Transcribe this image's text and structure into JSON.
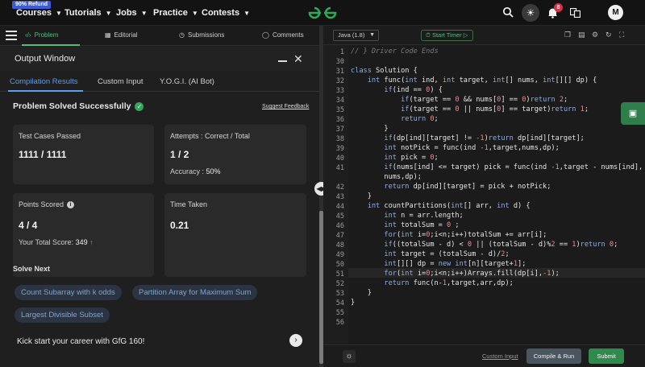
{
  "nav": {
    "refund_badge": "90% Refund",
    "items": [
      "Courses",
      "Tutorials",
      "Jobs",
      "Practice",
      "Contests"
    ],
    "notification_count": "8",
    "avatar_initial": "M"
  },
  "problem_tabs": [
    "Problem",
    "Editorial",
    "Submissions",
    "Comments"
  ],
  "output": {
    "title": "Output Window",
    "tabs": [
      "Compilation Results",
      "Custom Input",
      "Y.O.G.I. (AI Bot)"
    ],
    "status": "Problem Solved Successfully",
    "feedback": "Suggest Feedback",
    "cards": {
      "test_cases": {
        "label": "Test Cases Passed",
        "value": "1111 / 1111"
      },
      "attempts": {
        "label": "Attempts : Correct / Total",
        "value": "1 / 2",
        "sub_label": "Accuracy :",
        "sub_value": "50%"
      },
      "points": {
        "label": "Points Scored",
        "value": "4 / 4",
        "sub_label": "Your Total Score:",
        "sub_value": "349"
      },
      "time": {
        "label": "Time Taken",
        "value": "0.21"
      }
    },
    "solve_next": {
      "title": "Solve Next",
      "items": [
        "Count Subarray with k odds",
        "Partition Array for Maximum Sum",
        "Largest Divisible Subset"
      ]
    },
    "kickstart": "Kick start your career with GfG 160!"
  },
  "editor": {
    "language": "Java (1.8)",
    "timer_label": "Start Timer",
    "custom_input": "Custom Input",
    "compile_label": "Compile & Run",
    "submit_label": "Submit",
    "lines": [
      {
        "n": "1",
        "t": "// } Driver Code Ends"
      },
      {
        "n": "30",
        "t": ""
      },
      {
        "n": "31",
        "t": "class Solution {"
      },
      {
        "n": "32",
        "t": "    int func(int ind, int target, int[] nums, int[][] dp) {"
      },
      {
        "n": "33",
        "t": "        if(ind == 0) {"
      },
      {
        "n": "34",
        "t": "            if(target == 0 && nums[0] == 0)return 2;"
      },
      {
        "n": "35",
        "t": "            if(target == 0 || nums[0] == target)return 1;"
      },
      {
        "n": "36",
        "t": "            return 0;"
      },
      {
        "n": "37",
        "t": "        }"
      },
      {
        "n": "38",
        "t": "        if(dp[ind][target] != -1)return dp[ind][target];"
      },
      {
        "n": "39",
        "t": "        int notPick = func(ind -1,target,nums,dp);"
      },
      {
        "n": "40",
        "t": "        int pick = 0;"
      },
      {
        "n": "41",
        "t": "        if(nums[ind] <= target) pick = func(ind -1,target - nums[ind],"
      },
      {
        "n": "",
        "t": "        nums,dp);"
      },
      {
        "n": "42",
        "t": "        return dp[ind][target] = pick + notPick;"
      },
      {
        "n": "43",
        "t": "    }"
      },
      {
        "n": "44",
        "t": "    int countPartitions(int[] arr, int d) {"
      },
      {
        "n": "45",
        "t": "        int n = arr.length;"
      },
      {
        "n": "46",
        "t": "        int totalSum = 0 ;"
      },
      {
        "n": "47",
        "t": "        for(int i=0;i<n;i++)totalSum += arr[i];"
      },
      {
        "n": "48",
        "t": "        if((totalSum - d) < 0 || (totalSum - d)%2 == 1)return 0;"
      },
      {
        "n": "49",
        "t": "        int target = (totalSum - d)/2;"
      },
      {
        "n": "50",
        "t": "        int[][] dp = new int[n][target+1];"
      },
      {
        "n": "51",
        "t": "        for(int i=0;i<n;i++)Arrays.fill(dp[i],-1);"
      },
      {
        "n": "52",
        "t": "        return func(n-1,target,arr,dp);"
      },
      {
        "n": "53",
        "t": "    }"
      },
      {
        "n": "54",
        "t": "}"
      },
      {
        "n": "55",
        "t": ""
      },
      {
        "n": "56",
        "t": ""
      }
    ]
  },
  "colors": {
    "accent_green": "#2fa85a",
    "accent_blue": "#5c9df5"
  }
}
